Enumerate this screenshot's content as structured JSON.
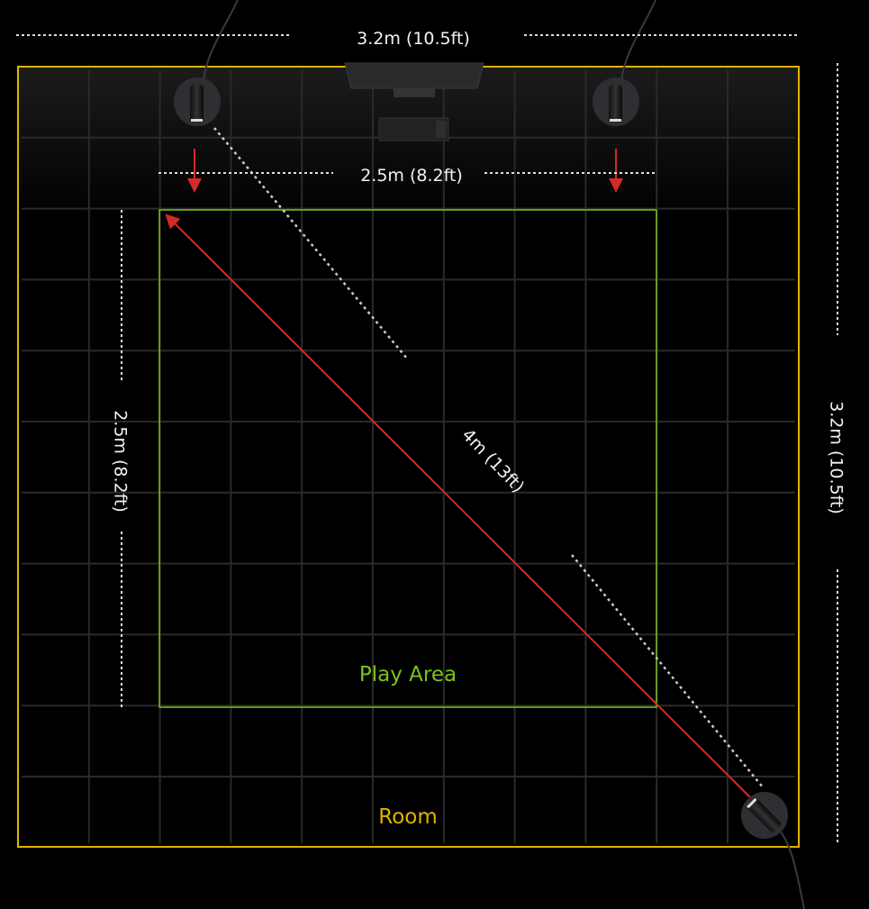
{
  "labels": {
    "room_width": "3.2m (10.5ft)",
    "room_depth": "3.2m (10.5ft)",
    "play_width": "2.5m (8.2ft)",
    "play_depth": "2.5m (8.2ft)",
    "diagonal": "4m (13ft)",
    "play_area": "Play Area",
    "room": "Room"
  },
  "colors": {
    "room_border": "#e0b400",
    "play_area_border": "#7cc21e",
    "diagonal_line": "#d42a2a",
    "room_label": "#e0b400",
    "play_area_label": "#7cc21e"
  },
  "icons": [
    "base-station-sensor",
    "base-station-sensor",
    "base-station-sensor",
    "monitor",
    "keyboard"
  ]
}
